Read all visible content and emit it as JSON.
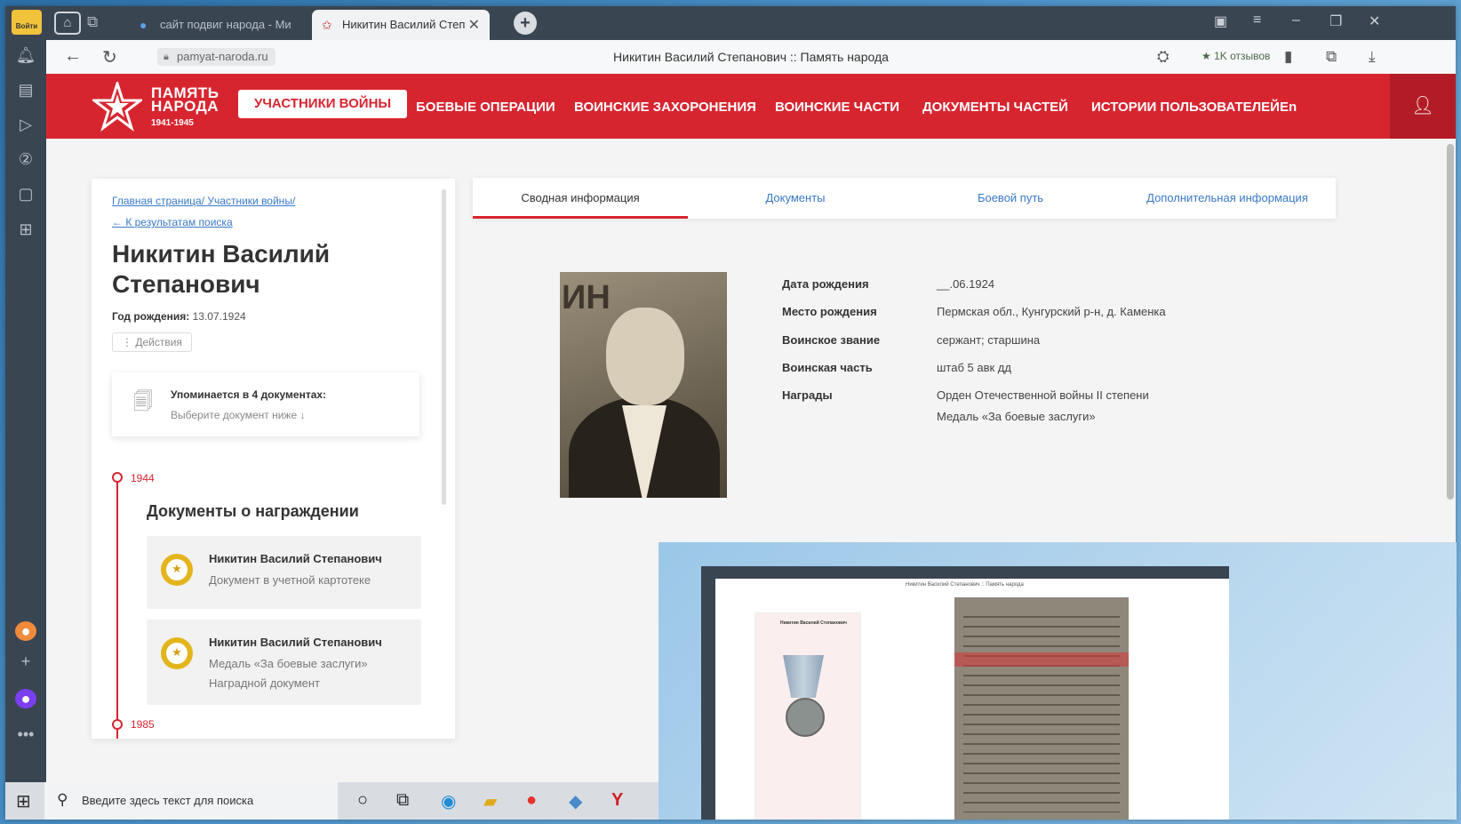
{
  "browser": {
    "tabs": [
      {
        "title": "сайт подвиг народа - Ми",
        "active": false
      },
      {
        "title": "Никитин Василий Степ",
        "active": true
      }
    ],
    "sidebar_badge": "Войти",
    "url": "pamyat-naroda.ru",
    "page_title": "Никитин Василий Степанович :: Память народа",
    "reviews": "★ 1K отзывов"
  },
  "site": {
    "logo_line1": "ПАМЯТЬ",
    "logo_line2": "НАРОДА",
    "logo_years": "1941-1945",
    "nav": [
      "УЧАСТНИКИ ВОЙНЫ",
      "БОЕВЫЕ ОПЕРАЦИИ",
      "ВОИНСКИЕ ЗАХОРОНЕНИЯ",
      "ВОИНСКИЕ ЧАСТИ",
      "ДОКУМЕНТЫ ЧАСТЕЙ",
      "ИСТОРИИ ПОЛЬЗОВАТЕЛЕЙ",
      "En"
    ]
  },
  "left": {
    "breadcrumb_home": "Главная страница/",
    "breadcrumb_section": "Участники войны/",
    "back_link": "← К результатам поиска",
    "name": "Никитин Василий Степанович",
    "birth_label": "Год рождения:",
    "birth_value": "13.07.1924",
    "actions": "⋮ Действия",
    "mention_title": "Упоминается в 4 документах:",
    "mention_sub": "Выберите документ ниже ↓",
    "year1": "1944",
    "year2": "1985",
    "awards_heading": "Документы о награждении",
    "awards": [
      {
        "name": "Никитин Василий Степанович",
        "line2": "Документ в учетной картотеке",
        "line3": ""
      },
      {
        "name": "Никитин Василий Степанович",
        "line2": "Медаль «За боевые заслуги»",
        "line3": "Наградной документ"
      }
    ]
  },
  "tabs": [
    "Сводная информация",
    "Документы",
    "Боевой путь",
    "Дополнительная информация"
  ],
  "info": [
    {
      "label": "Дата рождения",
      "value": "__.06.1924"
    },
    {
      "label": "Место рождения",
      "value": "Пермская обл., Кунгурский р-н, д. Каменка"
    },
    {
      "label": "Воинское звание",
      "value": "сержант; старшина"
    },
    {
      "label": "Воинская часть",
      "value": "штаб 5 авк дд"
    },
    {
      "label": "Награды",
      "value": "Орден Отечественной войны II степени"
    },
    {
      "label": "",
      "value": "Медаль «За боевые заслуги»"
    }
  ],
  "inset": {
    "window_title": "Никитин Василий Степанович :: Память народа",
    "card_name": "Никитин Василий Степанович"
  },
  "taskbar": {
    "search_placeholder": "Введите здесь текст для поиска"
  },
  "colors": {
    "brand_red": "#d72530",
    "link_blue": "#3a79c8",
    "medal_gold": "#e3b51c"
  }
}
